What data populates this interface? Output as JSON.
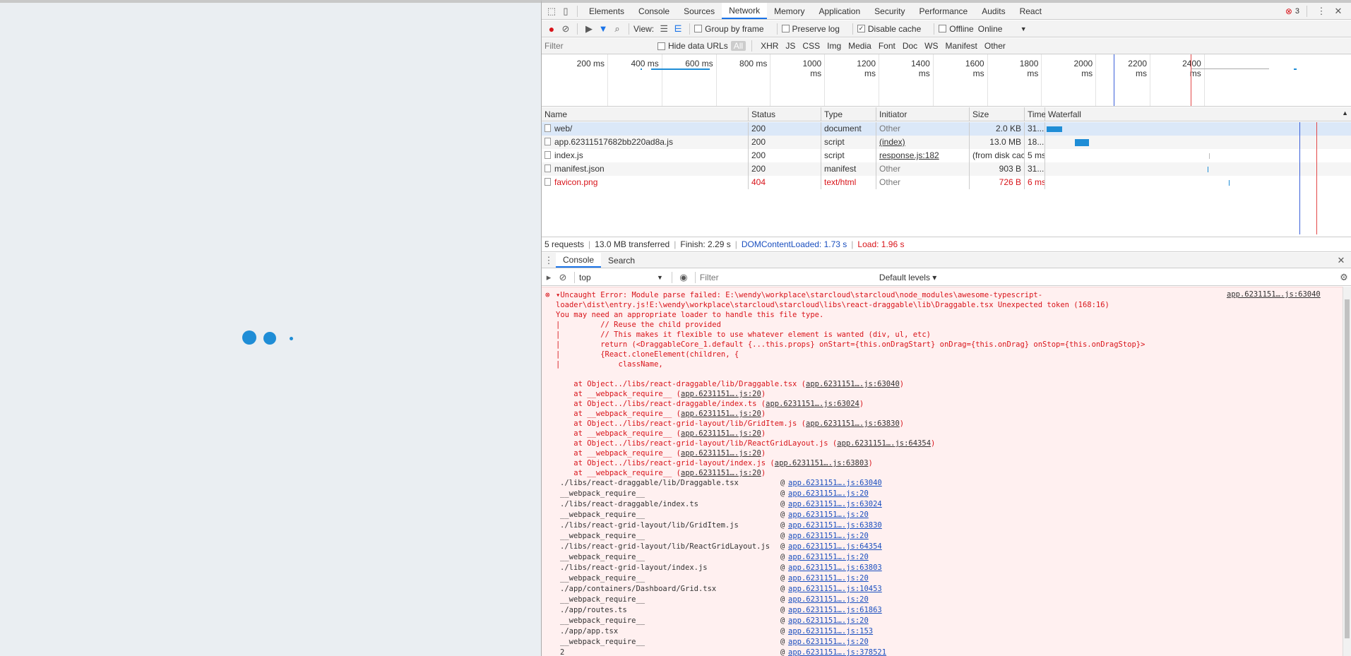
{
  "app": {
    "loading_indicator": "loading-dots"
  },
  "devtools": {
    "error_count": "3",
    "tabs": [
      "Elements",
      "Console",
      "Sources",
      "Network",
      "Memory",
      "Application",
      "Security",
      "Performance",
      "Audits",
      "React"
    ],
    "active_tab": "Network",
    "network_toolbar": {
      "view_label": "View:",
      "group_by_frame": "Group by frame",
      "preserve_log": "Preserve log",
      "disable_cache": "Disable cache",
      "offline": "Offline",
      "throttling": "Online"
    },
    "filter_bar": {
      "placeholder": "Filter",
      "hide_data_urls": "Hide data URLs",
      "types": [
        "All",
        "XHR",
        "JS",
        "CSS",
        "Img",
        "Media",
        "Font",
        "Doc",
        "WS",
        "Manifest",
        "Other"
      ]
    },
    "overview_ticks": [
      "200 ms",
      "400 ms",
      "600 ms",
      "800 ms",
      "1000 ms",
      "1200 ms",
      "1400 ms",
      "1600 ms",
      "1800 ms",
      "2000 ms",
      "2200 ms",
      "2400 ms"
    ],
    "columns": [
      "Name",
      "Status",
      "Type",
      "Initiator",
      "Size",
      "Time",
      "Waterfall"
    ],
    "requests": [
      {
        "name": "web/",
        "status": "200",
        "type": "document",
        "initiator": "Other",
        "size": "2.0 KB",
        "time": "31...",
        "error": false,
        "selected": true
      },
      {
        "name": "app.62311517682bb220ad8a.js",
        "status": "200",
        "type": "script",
        "initiator": "(index)",
        "size": "13.0 MB",
        "time": "18...",
        "error": false,
        "selected": false
      },
      {
        "name": "index.js",
        "status": "200",
        "type": "script",
        "initiator": "response.js:182",
        "size": "(from disk cac...",
        "time": "5 ms",
        "error": false,
        "selected": false
      },
      {
        "name": "manifest.json",
        "status": "200",
        "type": "manifest",
        "initiator": "Other",
        "size": "903 B",
        "time": "31...",
        "error": false,
        "selected": false
      },
      {
        "name": "favicon.png",
        "status": "404",
        "type": "text/html",
        "initiator": "Other",
        "size": "726 B",
        "time": "6 ms",
        "error": true,
        "selected": false
      }
    ],
    "summary": {
      "requests": "5 requests",
      "transferred": "13.0 MB transferred",
      "finish": "Finish: 2.29 s",
      "dom_content_loaded": "DOMContentLoaded: 1.73 s",
      "load": "Load: 1.96 s"
    },
    "drawer_tabs": [
      "Console",
      "Search"
    ],
    "console_toolbar": {
      "context": "top",
      "filter_placeholder": "Filter",
      "levels": "Default levels ▾"
    },
    "error": {
      "source_link": "app.6231151….js:63040",
      "message_lines": [
        "▾Uncaught Error: Module parse failed: E:\\wendy\\workplace\\starcloud\\starcloud\\node_modules\\awesome-typescript-",
        "loader\\dist\\entry.js!E:\\wendy\\workplace\\starcloud\\starcloud\\libs\\react-draggable\\lib\\Draggable.tsx Unexpected token (168:16)",
        "You may need an appropriate loader to handle this file type.",
        "|         // Reuse the child provided",
        "|         // This makes it flexible to use whatever element is wanted (div, ul, etc)",
        "|         return (<DraggableCore_1.default {...this.props} onStart={this.onDragStart} onDrag={this.onDrag} onStop={this.onDragStop}>",
        "|         {React.cloneElement(children, {",
        "|             className,",
        ""
      ],
      "trace": [
        {
          "text": "    at Object../libs/react-draggable/lib/Draggable.tsx (",
          "link": "app.6231151….js:63040",
          "end": ")"
        },
        {
          "text": "    at __webpack_require__ (",
          "link": "app.6231151….js:20",
          "end": ")"
        },
        {
          "text": "    at Object../libs/react-draggable/index.ts (",
          "link": "app.6231151….js:63024",
          "end": ")"
        },
        {
          "text": "    at __webpack_require__ (",
          "link": "app.6231151….js:20",
          "end": ")"
        },
        {
          "text": "    at Object../libs/react-grid-layout/lib/GridItem.js (",
          "link": "app.6231151….js:63830",
          "end": ")"
        },
        {
          "text": "    at __webpack_require__ (",
          "link": "app.6231151….js:20",
          "end": ")"
        },
        {
          "text": "    at Object../libs/react-grid-layout/lib/ReactGridLayout.js (",
          "link": "app.6231151….js:64354",
          "end": ")"
        },
        {
          "text": "    at __webpack_require__ (",
          "link": "app.6231151….js:20",
          "end": ")"
        },
        {
          "text": "    at Object../libs/react-grid-layout/index.js (",
          "link": "app.6231151….js:63803",
          "end": ")"
        },
        {
          "text": "    at __webpack_require__ (",
          "link": "app.6231151….js:20",
          "end": ")"
        }
      ],
      "stack": [
        {
          "fn": "./libs/react-draggable/lib/Draggable.tsx",
          "link": "app.6231151….js:63040"
        },
        {
          "fn": "__webpack_require__",
          "link": "app.6231151….js:20"
        },
        {
          "fn": "./libs/react-draggable/index.ts",
          "link": "app.6231151….js:63024"
        },
        {
          "fn": "__webpack_require__",
          "link": "app.6231151….js:20"
        },
        {
          "fn": "./libs/react-grid-layout/lib/GridItem.js",
          "link": "app.6231151….js:63830"
        },
        {
          "fn": "__webpack_require__",
          "link": "app.6231151….js:20"
        },
        {
          "fn": "./libs/react-grid-layout/lib/ReactGridLayout.js",
          "link": "app.6231151….js:64354"
        },
        {
          "fn": "__webpack_require__",
          "link": "app.6231151….js:20"
        },
        {
          "fn": "./libs/react-grid-layout/index.js",
          "link": "app.6231151….js:63803"
        },
        {
          "fn": "__webpack_require__",
          "link": "app.6231151….js:20"
        },
        {
          "fn": "./app/containers/Dashboard/Grid.tsx",
          "link": "app.6231151….js:10453"
        },
        {
          "fn": "__webpack_require__",
          "link": "app.6231151….js:20"
        },
        {
          "fn": "./app/routes.ts",
          "link": "app.6231151….js:61863"
        },
        {
          "fn": "__webpack_require__",
          "link": "app.6231151….js:20"
        },
        {
          "fn": "./app/app.tsx",
          "link": "app.6231151….js:153"
        },
        {
          "fn": "__webpack_require__",
          "link": "app.6231151….js:20"
        },
        {
          "fn": "2",
          "link": "app.6231151….js:378521"
        }
      ]
    }
  }
}
